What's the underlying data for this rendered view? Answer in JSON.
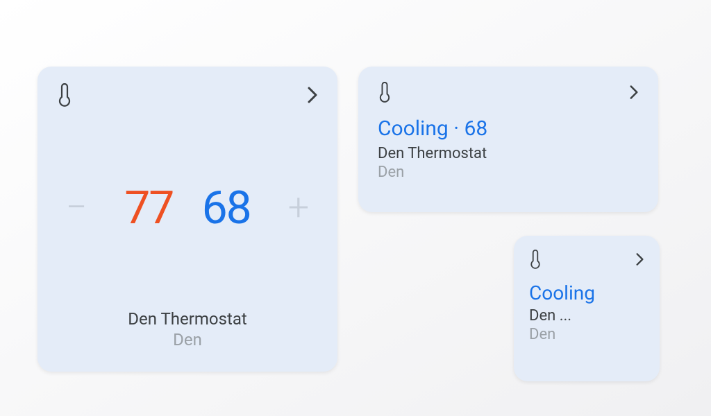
{
  "colors": {
    "card_bg": "#e4ecf8",
    "heat": "#ee5022",
    "cool": "#1a73e8",
    "text_primary": "#3c4043",
    "text_secondary": "#9aa0a6",
    "stepper_disabled": "#c7cfdb"
  },
  "icons": {
    "thermostat": "thermostat-icon",
    "chevron_right": "chevron-right-icon",
    "minus": "minus-icon",
    "plus": "plus-icon"
  },
  "large_card": {
    "heat_setpoint": "77",
    "cool_setpoint": "68",
    "device_name": "Den Thermostat",
    "room": "Den"
  },
  "medium_card": {
    "status_line": "Cooling · 68",
    "device_name": "Den Thermostat",
    "room": "Den"
  },
  "small_card": {
    "status_line": "Cooling",
    "device_name_truncated": "Den ...",
    "room": "Den"
  }
}
